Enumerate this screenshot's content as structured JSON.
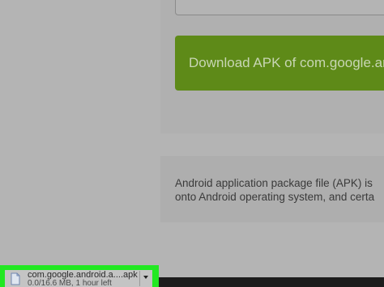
{
  "main": {
    "download_button_label": "Download APK of com.google.android",
    "info_line1": "Android application package file (APK) is",
    "info_line2": "onto Android operating system, and certa"
  },
  "download_shelf": {
    "file_name": "com.google.android.a....apk",
    "status": "0.0/16.6 MB, 1 hour left",
    "highlight_color": "#22e822"
  }
}
